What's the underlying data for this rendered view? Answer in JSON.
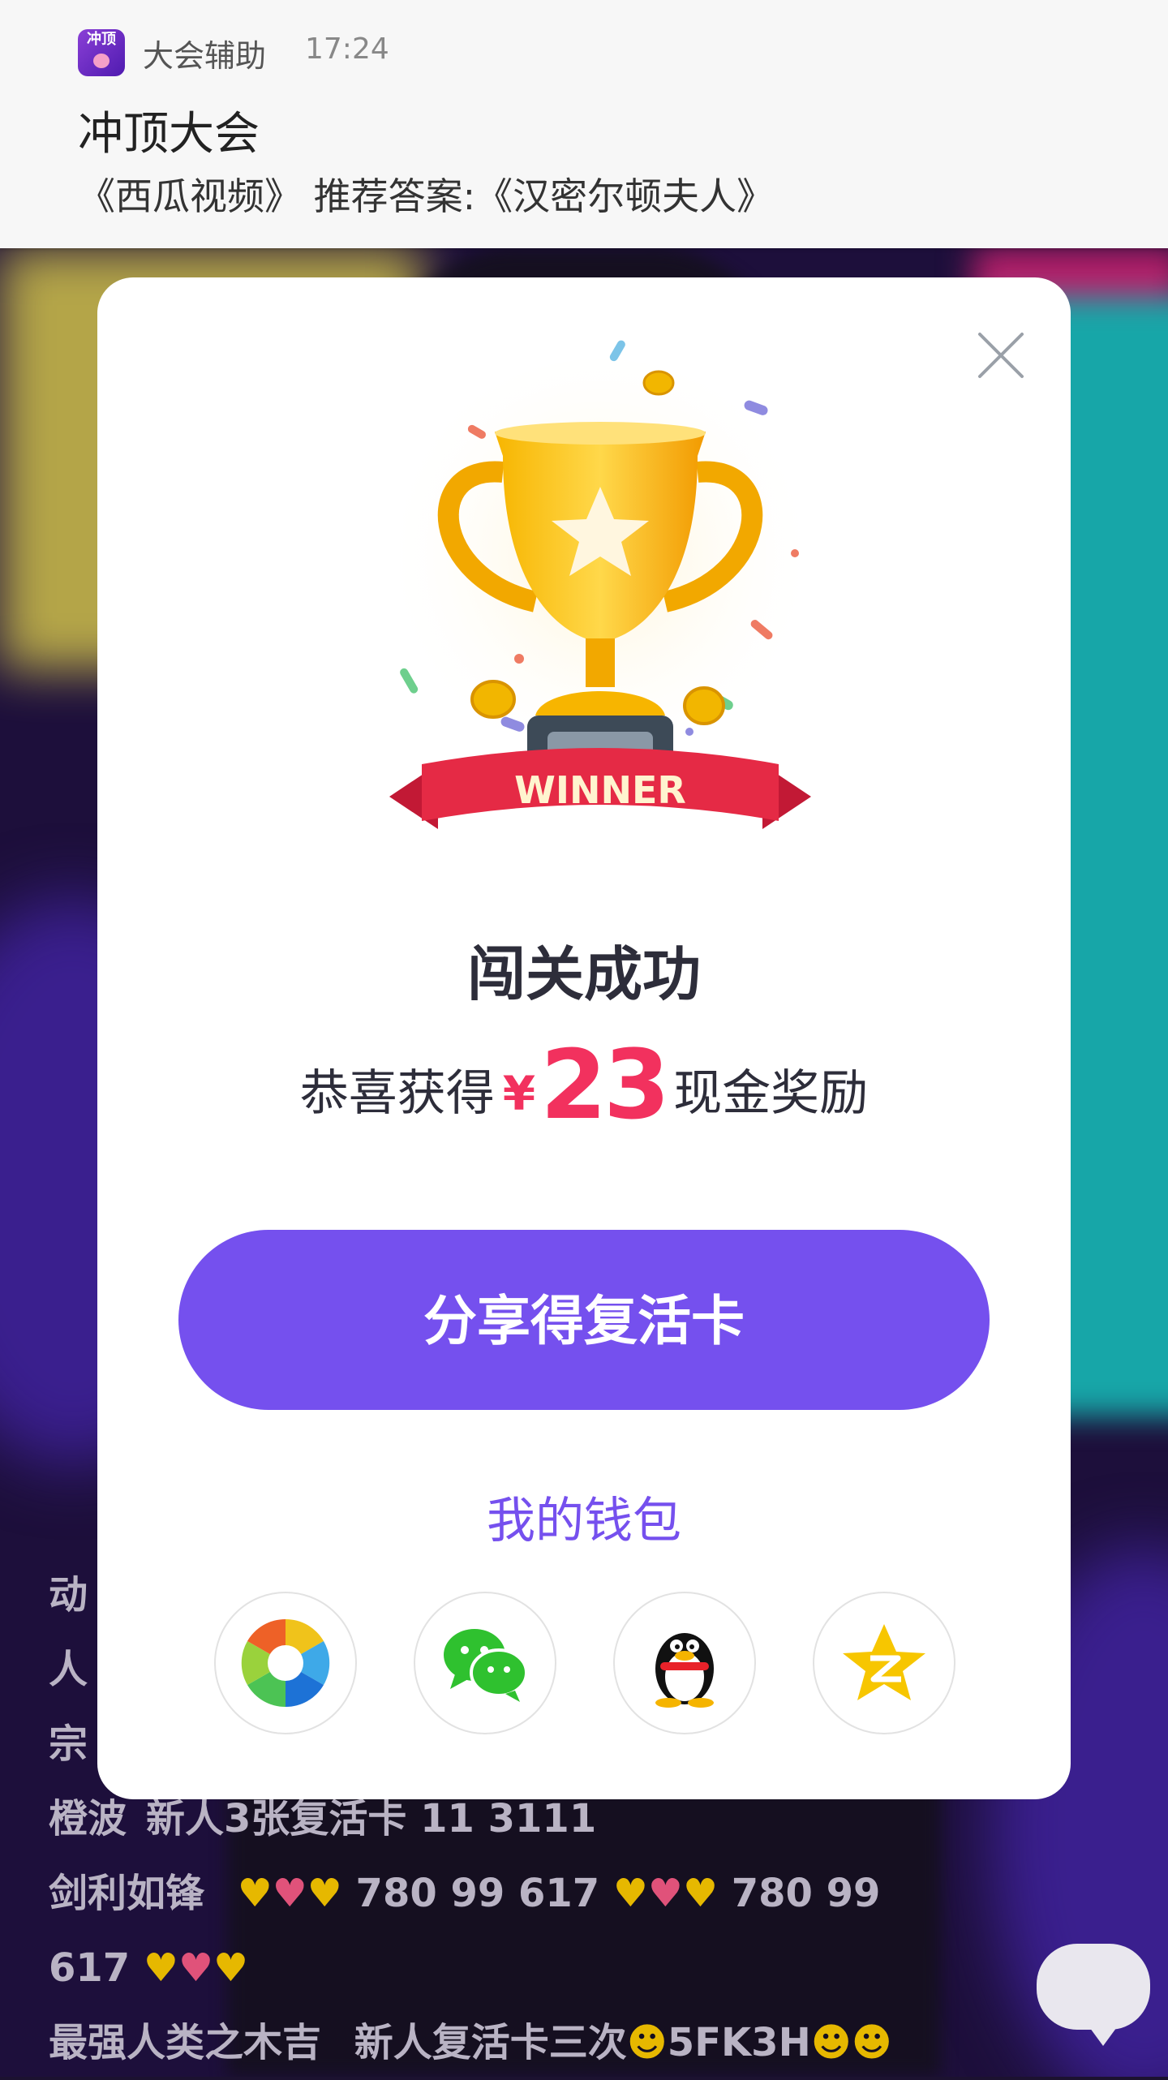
{
  "notification": {
    "app_icon_text": "冲顶",
    "app_name": "大会辅助",
    "time": "17:24",
    "title": "冲顶大会",
    "body": "《西瓜视频》 推荐答案:《汉密尔顿夫人》"
  },
  "modal": {
    "badge_text": "WINNER",
    "title": "闯关成功",
    "prize_prefix": "恭喜获得",
    "currency": "¥",
    "amount": "23",
    "prize_suffix": "现金奖励",
    "share_button": "分享得复活卡",
    "wallet_link": "我的钱包",
    "share_targets": [
      {
        "icon": "photo-aperture-icon"
      },
      {
        "icon": "wechat-icon"
      },
      {
        "icon": "qq-penguin-icon"
      },
      {
        "icon": "qzone-star-icon"
      }
    ]
  },
  "chat": {
    "partial_lines": [
      "动",
      "人",
      "宗"
    ],
    "line4_name": "橙波",
    "line4_text": "新人3张复活卡 11 3111",
    "line5_name": "剑利如锋",
    "line5_text_a": "780 99 617",
    "line5_text_b": "780 99",
    "line6_text": "617",
    "line7_name": "最强人类之木吉",
    "line7_text": "新人复活卡三次",
    "line7_code": "5FK3H"
  },
  "colors": {
    "accent_purple": "#7550ee",
    "prize_red": "#f2315e",
    "title_text": "#2d2d3a"
  }
}
